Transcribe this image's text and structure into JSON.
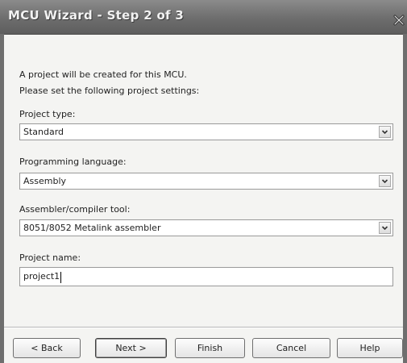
{
  "window": {
    "title": "MCU Wizard - Step 2 of 3"
  },
  "intro": {
    "line1": "A project will be created for this MCU.",
    "line2": "Please set the following project settings:"
  },
  "fields": {
    "project_type": {
      "label": "Project type:",
      "value": "Standard"
    },
    "programming_language": {
      "label": "Programming language:",
      "value": "Assembly"
    },
    "assembler_tool": {
      "label": "Assembler/compiler tool:",
      "value": "8051/8052 Metalink assembler"
    },
    "project_name": {
      "label": "Project name:",
      "value": "project1"
    }
  },
  "buttons": {
    "back": "< Back",
    "next": "Next >",
    "finish": "Finish",
    "cancel": "Cancel",
    "help": "Help"
  },
  "icons": {
    "close": "close-icon",
    "dropdown": "chevron-down-icon"
  }
}
